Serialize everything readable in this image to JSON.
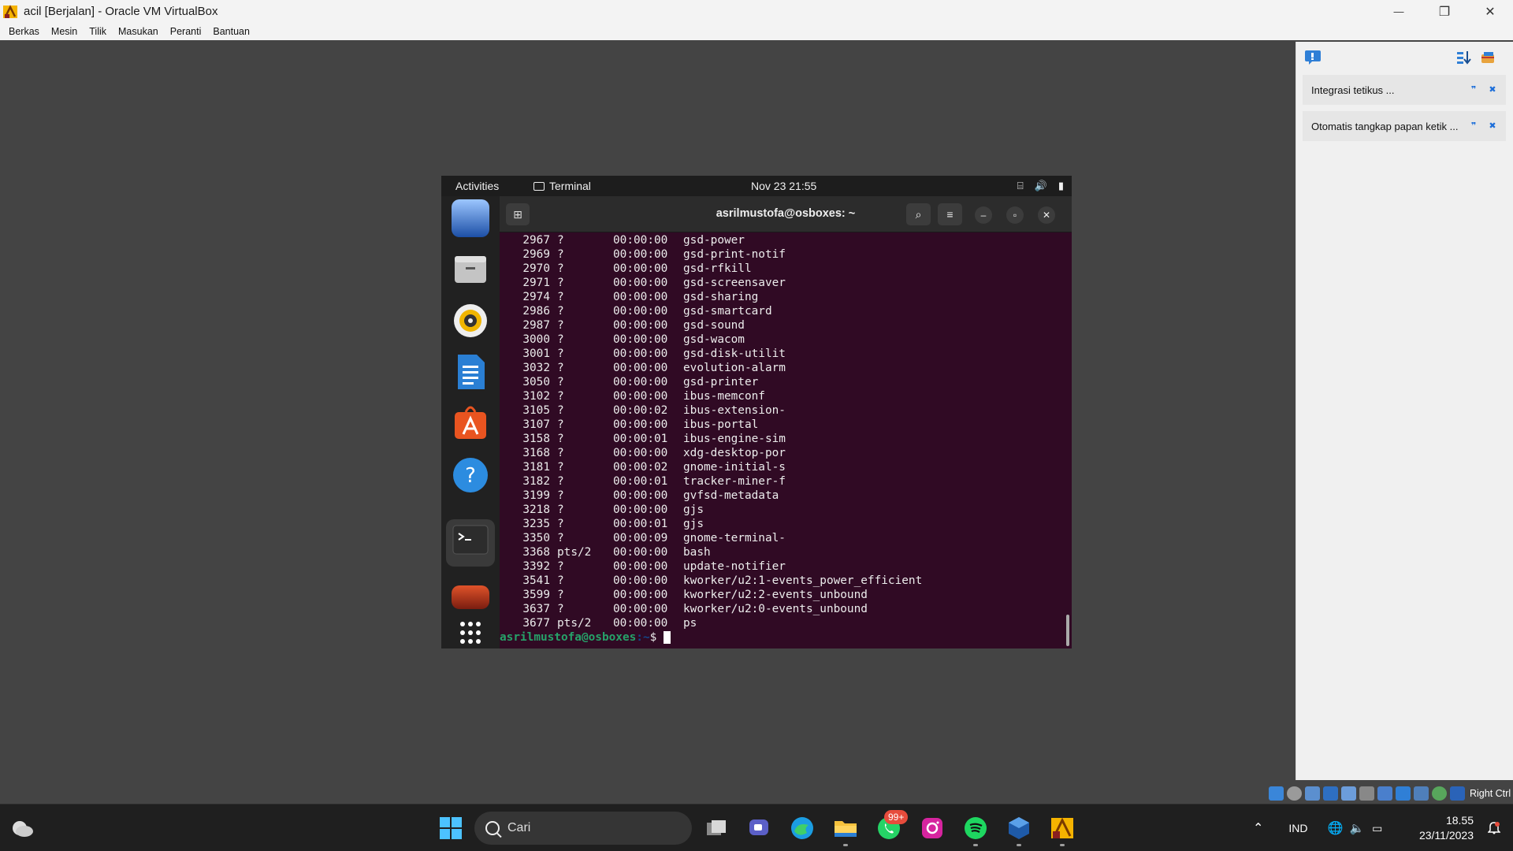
{
  "window": {
    "title": "acil [Berjalan] - Oracle VM VirtualBox",
    "minimize_glyph": "—",
    "restore_glyph": "❐",
    "close_glyph": "✕"
  },
  "menu": [
    "Berkas",
    "Mesin",
    "Tilik",
    "Masukan",
    "Peranti",
    "Bantuan"
  ],
  "vbox_notifications": [
    {
      "text": "Integrasi tetikus ..."
    },
    {
      "text": "Otomatis tangkap papan ketik ..."
    }
  ],
  "status_strip": {
    "host_key": "Right Ctrl"
  },
  "guest": {
    "activities": "Activities",
    "app_name": "Terminal",
    "clock": "Nov 23  21:55",
    "terminal_title": "asrilmustofa@osboxes: ~",
    "processes": [
      {
        "pid": "2967",
        "tty": "?",
        "time": "00:00:00",
        "cmd": "gsd-power"
      },
      {
        "pid": "2969",
        "tty": "?",
        "time": "00:00:00",
        "cmd": "gsd-print-notif"
      },
      {
        "pid": "2970",
        "tty": "?",
        "time": "00:00:00",
        "cmd": "gsd-rfkill"
      },
      {
        "pid": "2971",
        "tty": "?",
        "time": "00:00:00",
        "cmd": "gsd-screensaver"
      },
      {
        "pid": "2974",
        "tty": "?",
        "time": "00:00:00",
        "cmd": "gsd-sharing"
      },
      {
        "pid": "2986",
        "tty": "?",
        "time": "00:00:00",
        "cmd": "gsd-smartcard"
      },
      {
        "pid": "2987",
        "tty": "?",
        "time": "00:00:00",
        "cmd": "gsd-sound"
      },
      {
        "pid": "3000",
        "tty": "?",
        "time": "00:00:00",
        "cmd": "gsd-wacom"
      },
      {
        "pid": "3001",
        "tty": "?",
        "time": "00:00:00",
        "cmd": "gsd-disk-utilit"
      },
      {
        "pid": "3032",
        "tty": "?",
        "time": "00:00:00",
        "cmd": "evolution-alarm"
      },
      {
        "pid": "3050",
        "tty": "?",
        "time": "00:00:00",
        "cmd": "gsd-printer"
      },
      {
        "pid": "3102",
        "tty": "?",
        "time": "00:00:00",
        "cmd": "ibus-memconf"
      },
      {
        "pid": "3105",
        "tty": "?",
        "time": "00:00:02",
        "cmd": "ibus-extension-"
      },
      {
        "pid": "3107",
        "tty": "?",
        "time": "00:00:00",
        "cmd": "ibus-portal"
      },
      {
        "pid": "3158",
        "tty": "?",
        "time": "00:00:01",
        "cmd": "ibus-engine-sim"
      },
      {
        "pid": "3168",
        "tty": "?",
        "time": "00:00:00",
        "cmd": "xdg-desktop-por"
      },
      {
        "pid": "3181",
        "tty": "?",
        "time": "00:00:02",
        "cmd": "gnome-initial-s"
      },
      {
        "pid": "3182",
        "tty": "?",
        "time": "00:00:01",
        "cmd": "tracker-miner-f"
      },
      {
        "pid": "3199",
        "tty": "?",
        "time": "00:00:00",
        "cmd": "gvfsd-metadata"
      },
      {
        "pid": "3218",
        "tty": "?",
        "time": "00:00:00",
        "cmd": "gjs"
      },
      {
        "pid": "3235",
        "tty": "?",
        "time": "00:00:01",
        "cmd": "gjs"
      },
      {
        "pid": "3350",
        "tty": "?",
        "time": "00:00:09",
        "cmd": "gnome-terminal-"
      },
      {
        "pid": "3368",
        "tty": "pts/2",
        "time": "00:00:00",
        "cmd": "bash"
      },
      {
        "pid": "3392",
        "tty": "?",
        "time": "00:00:00",
        "cmd": "update-notifier"
      },
      {
        "pid": "3541",
        "tty": "?",
        "time": "00:00:00",
        "cmd": "kworker/u2:1-events_power_efficient"
      },
      {
        "pid": "3599",
        "tty": "?",
        "time": "00:00:00",
        "cmd": "kworker/u2:2-events_unbound"
      },
      {
        "pid": "3637",
        "tty": "?",
        "time": "00:00:00",
        "cmd": "kworker/u2:0-events_unbound"
      },
      {
        "pid": "3677",
        "tty": "pts/2",
        "time": "00:00:00",
        "cmd": "ps"
      }
    ],
    "prompt_user": "asrilmustofa@osboxes",
    "prompt_path": ":~",
    "prompt_symbol": "$ "
  },
  "taskbar": {
    "search_placeholder": "Cari",
    "whatsapp_badge": "99+",
    "language": "IND",
    "time": "18.55",
    "date": "23/11/2023"
  }
}
